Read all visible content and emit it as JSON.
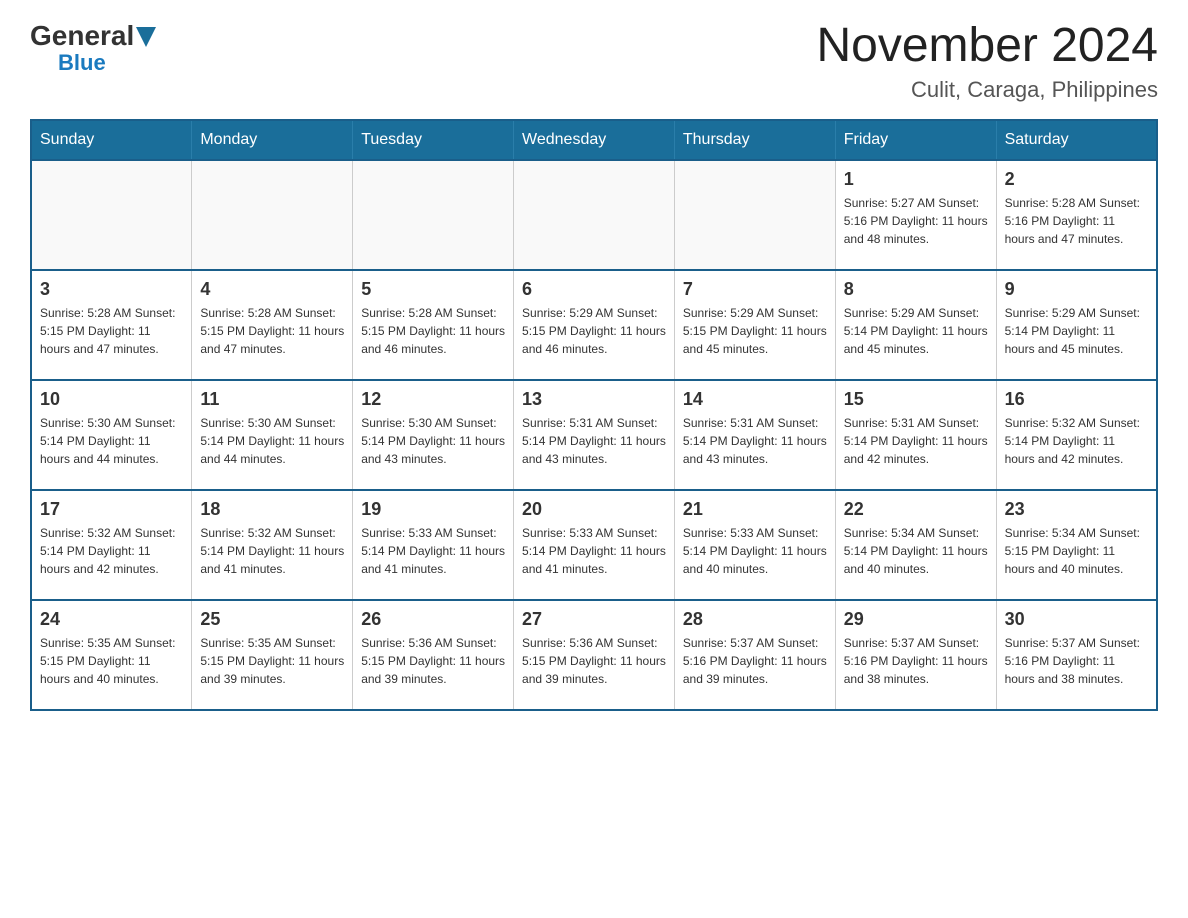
{
  "header": {
    "logo_general": "General",
    "logo_blue": "Blue",
    "month_title": "November 2024",
    "location": "Culit, Caraga, Philippines"
  },
  "calendar": {
    "days_of_week": [
      "Sunday",
      "Monday",
      "Tuesday",
      "Wednesday",
      "Thursday",
      "Friday",
      "Saturday"
    ],
    "weeks": [
      [
        {
          "day": "",
          "info": ""
        },
        {
          "day": "",
          "info": ""
        },
        {
          "day": "",
          "info": ""
        },
        {
          "day": "",
          "info": ""
        },
        {
          "day": "",
          "info": ""
        },
        {
          "day": "1",
          "info": "Sunrise: 5:27 AM\nSunset: 5:16 PM\nDaylight: 11 hours and 48 minutes."
        },
        {
          "day": "2",
          "info": "Sunrise: 5:28 AM\nSunset: 5:16 PM\nDaylight: 11 hours and 47 minutes."
        }
      ],
      [
        {
          "day": "3",
          "info": "Sunrise: 5:28 AM\nSunset: 5:15 PM\nDaylight: 11 hours and 47 minutes."
        },
        {
          "day": "4",
          "info": "Sunrise: 5:28 AM\nSunset: 5:15 PM\nDaylight: 11 hours and 47 minutes."
        },
        {
          "day": "5",
          "info": "Sunrise: 5:28 AM\nSunset: 5:15 PM\nDaylight: 11 hours and 46 minutes."
        },
        {
          "day": "6",
          "info": "Sunrise: 5:29 AM\nSunset: 5:15 PM\nDaylight: 11 hours and 46 minutes."
        },
        {
          "day": "7",
          "info": "Sunrise: 5:29 AM\nSunset: 5:15 PM\nDaylight: 11 hours and 45 minutes."
        },
        {
          "day": "8",
          "info": "Sunrise: 5:29 AM\nSunset: 5:14 PM\nDaylight: 11 hours and 45 minutes."
        },
        {
          "day": "9",
          "info": "Sunrise: 5:29 AM\nSunset: 5:14 PM\nDaylight: 11 hours and 45 minutes."
        }
      ],
      [
        {
          "day": "10",
          "info": "Sunrise: 5:30 AM\nSunset: 5:14 PM\nDaylight: 11 hours and 44 minutes."
        },
        {
          "day": "11",
          "info": "Sunrise: 5:30 AM\nSunset: 5:14 PM\nDaylight: 11 hours and 44 minutes."
        },
        {
          "day": "12",
          "info": "Sunrise: 5:30 AM\nSunset: 5:14 PM\nDaylight: 11 hours and 43 minutes."
        },
        {
          "day": "13",
          "info": "Sunrise: 5:31 AM\nSunset: 5:14 PM\nDaylight: 11 hours and 43 minutes."
        },
        {
          "day": "14",
          "info": "Sunrise: 5:31 AM\nSunset: 5:14 PM\nDaylight: 11 hours and 43 minutes."
        },
        {
          "day": "15",
          "info": "Sunrise: 5:31 AM\nSunset: 5:14 PM\nDaylight: 11 hours and 42 minutes."
        },
        {
          "day": "16",
          "info": "Sunrise: 5:32 AM\nSunset: 5:14 PM\nDaylight: 11 hours and 42 minutes."
        }
      ],
      [
        {
          "day": "17",
          "info": "Sunrise: 5:32 AM\nSunset: 5:14 PM\nDaylight: 11 hours and 42 minutes."
        },
        {
          "day": "18",
          "info": "Sunrise: 5:32 AM\nSunset: 5:14 PM\nDaylight: 11 hours and 41 minutes."
        },
        {
          "day": "19",
          "info": "Sunrise: 5:33 AM\nSunset: 5:14 PM\nDaylight: 11 hours and 41 minutes."
        },
        {
          "day": "20",
          "info": "Sunrise: 5:33 AM\nSunset: 5:14 PM\nDaylight: 11 hours and 41 minutes."
        },
        {
          "day": "21",
          "info": "Sunrise: 5:33 AM\nSunset: 5:14 PM\nDaylight: 11 hours and 40 minutes."
        },
        {
          "day": "22",
          "info": "Sunrise: 5:34 AM\nSunset: 5:14 PM\nDaylight: 11 hours and 40 minutes."
        },
        {
          "day": "23",
          "info": "Sunrise: 5:34 AM\nSunset: 5:15 PM\nDaylight: 11 hours and 40 minutes."
        }
      ],
      [
        {
          "day": "24",
          "info": "Sunrise: 5:35 AM\nSunset: 5:15 PM\nDaylight: 11 hours and 40 minutes."
        },
        {
          "day": "25",
          "info": "Sunrise: 5:35 AM\nSunset: 5:15 PM\nDaylight: 11 hours and 39 minutes."
        },
        {
          "day": "26",
          "info": "Sunrise: 5:36 AM\nSunset: 5:15 PM\nDaylight: 11 hours and 39 minutes."
        },
        {
          "day": "27",
          "info": "Sunrise: 5:36 AM\nSunset: 5:15 PM\nDaylight: 11 hours and 39 minutes."
        },
        {
          "day": "28",
          "info": "Sunrise: 5:37 AM\nSunset: 5:16 PM\nDaylight: 11 hours and 39 minutes."
        },
        {
          "day": "29",
          "info": "Sunrise: 5:37 AM\nSunset: 5:16 PM\nDaylight: 11 hours and 38 minutes."
        },
        {
          "day": "30",
          "info": "Sunrise: 5:37 AM\nSunset: 5:16 PM\nDaylight: 11 hours and 38 minutes."
        }
      ]
    ]
  }
}
